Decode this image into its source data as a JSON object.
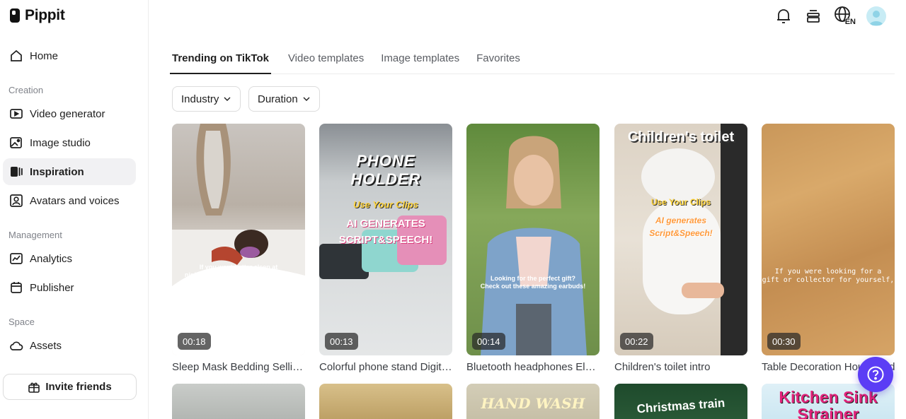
{
  "app": {
    "name": "Pippit"
  },
  "sidebar": {
    "home": "Home",
    "sections": {
      "creation": "Creation",
      "management": "Management",
      "space": "Space"
    },
    "creation_items": [
      {
        "label": "Video generator",
        "icon": "video-generator-icon"
      },
      {
        "label": "Image studio",
        "icon": "image-studio-icon"
      },
      {
        "label": "Inspiration",
        "icon": "inspiration-icon",
        "active": true
      },
      {
        "label": "Avatars and voices",
        "icon": "avatar-voice-icon"
      }
    ],
    "management_items": [
      {
        "label": "Analytics",
        "icon": "analytics-icon"
      },
      {
        "label": "Publisher",
        "icon": "calendar-icon"
      }
    ],
    "space_items": [
      {
        "label": "Assets",
        "icon": "cloud-icon"
      }
    ],
    "invite_label": "Invite friends"
  },
  "header": {
    "language": "EN"
  },
  "tabs": [
    {
      "label": "Trending on TikTok",
      "active": true
    },
    {
      "label": "Video templates"
    },
    {
      "label": "Image templates"
    },
    {
      "label": "Favorites"
    }
  ],
  "filters": {
    "industry": "Industry",
    "duration": "Duration"
  },
  "cards": [
    {
      "title": "Sleep Mask Bedding Selling Point",
      "duration": "00:18",
      "overlay": [
        "If you want better sleep at",
        "night but don't know where to start,",
        "watch this."
      ]
    },
    {
      "title": "Colorful phone stand Digital Ad",
      "duration": "00:13",
      "overlay_title": "PHONE HOLDER",
      "overlay_line1": "Use Your Clips",
      "overlay_line2": "AI GENERATES",
      "overlay_line3": "SCRIPT&SPEECH!"
    },
    {
      "title": "Bluetooth headphones Electronics",
      "duration": "00:14",
      "overlay": [
        "Looking for the perfect gift?",
        "Check out these amazing earbuds!"
      ]
    },
    {
      "title": "Children's toilet intro",
      "duration": "00:22",
      "overlay_title": "Children's toilet",
      "overlay_line1": "Use Your Clips",
      "overlay_line2": "AI generates",
      "overlay_line3": "Script&Speech!"
    },
    {
      "title": "Table Decoration Household",
      "duration": "00:30",
      "overlay": [
        "If you were looking for a",
        "gift or collector for yourself,"
      ]
    }
  ],
  "bottom_row": [
    {
      "overlay": ""
    },
    {
      "overlay": ""
    },
    {
      "overlay": "HAND WASH"
    },
    {
      "overlay": "Christmas train"
    },
    {
      "overlay": "Kitchen Sink Strainer"
    }
  ],
  "colors": {
    "accent": "#5b3df5",
    "active_bg": "#f1f1f3",
    "border": "#dcdcdc"
  }
}
